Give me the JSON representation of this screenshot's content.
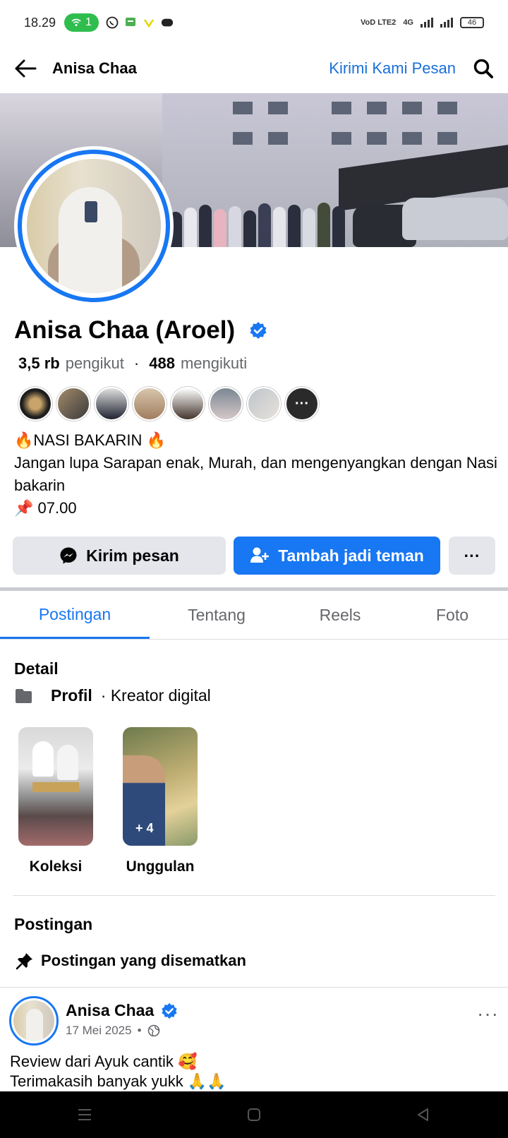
{
  "status_bar": {
    "time": "18.29",
    "hotspot_count": "1",
    "network_label": "VoD LTE2",
    "signal_label": "4G",
    "battery": "46"
  },
  "header": {
    "title": "Anisa Chaa",
    "link": "Kirimi Kami Pesan"
  },
  "profile": {
    "name": "Anisa Chaa (Aroel)",
    "followers_count": "3,5 rb",
    "followers_label": "pengikut",
    "following_count": "488",
    "following_label": "mengikuti",
    "bio_line1": "🔥NASI BAKARIN 🔥",
    "bio_line2": "Jangan lupa Sarapan enak, Murah, dan mengenyangkan dengan Nasi bakarin",
    "bio_line3": "📌 07.00",
    "friends_more": "···"
  },
  "actions": {
    "message": "Kirim pesan",
    "add_friend": "Tambah jadi teman",
    "more": "···"
  },
  "tabs": [
    {
      "label": "Postingan"
    },
    {
      "label": "Tentang"
    },
    {
      "label": "Reels"
    },
    {
      "label": "Foto"
    }
  ],
  "detail": {
    "title": "Detail",
    "profile_label": "Profil",
    "profile_type": "· Kreator digital"
  },
  "highlights": [
    {
      "label": "Koleksi",
      "count": ""
    },
    {
      "label": "Unggulan",
      "count": "+ 4"
    }
  ],
  "posts_section": {
    "title": "Postingan",
    "pinned_label": "Postingan yang disematkan"
  },
  "post": {
    "author": "Anisa Chaa",
    "date": "17 Mei 2025",
    "separator": "•",
    "more": "···",
    "line1": "Review dari Ayuk cantik 🥰",
    "line2": "Terimakasih banyak yukk 🙏🙏"
  },
  "colors": {
    "accent": "#1877f2",
    "button_grey": "#e4e6eb",
    "text_muted": "#65676b"
  }
}
